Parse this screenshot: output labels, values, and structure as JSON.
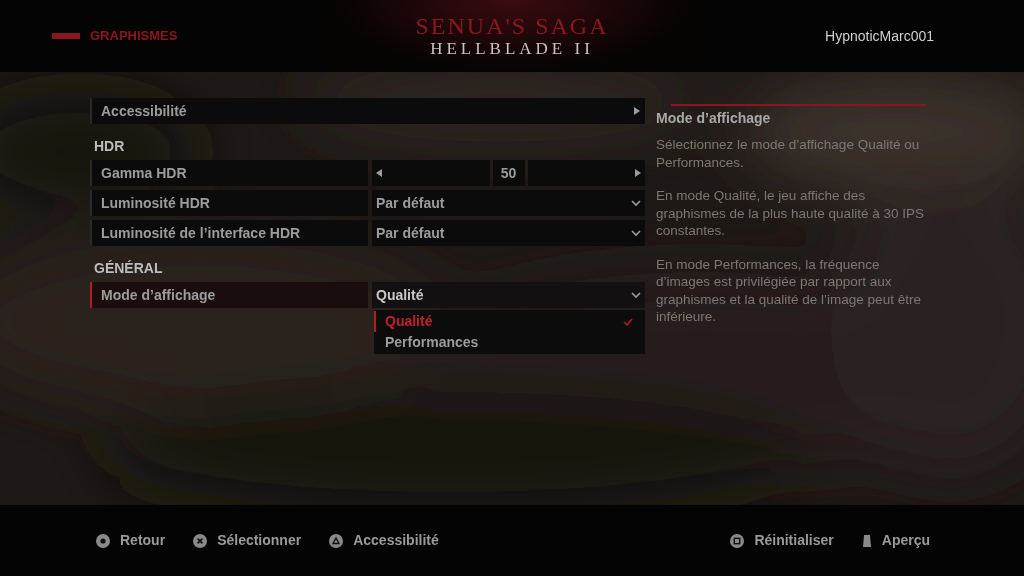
{
  "header": {
    "section": "GRAPHISMES",
    "logo_top": "SENUA'S SAGA",
    "logo_bottom": "HELLBLADE II",
    "user": "HypnoticMarc001"
  },
  "settings": [
    {
      "kind": "link",
      "label": "Accessibilité",
      "selected": false
    },
    {
      "kind": "section",
      "label": "HDR"
    },
    {
      "kind": "slider",
      "label": "Gamma HDR",
      "value": "50",
      "selected": false
    },
    {
      "kind": "dropdown",
      "label": "Luminosité HDR",
      "value": "Par défaut",
      "selected": false,
      "expanded": false
    },
    {
      "kind": "dropdown",
      "label": "Luminosité de l’interface HDR",
      "value": "Par défaut",
      "selected": false,
      "expanded": false
    },
    {
      "kind": "section",
      "label": "GÉNÉRAL"
    },
    {
      "kind": "dropdown",
      "label": "Mode d’affichage",
      "value": "Qualité",
      "selected": true,
      "expanded": true,
      "options": [
        {
          "label": "Qualité",
          "selected": true
        },
        {
          "label": "Performances",
          "selected": false
        }
      ]
    }
  ],
  "description": {
    "title": "Mode d’affichage",
    "paragraphs": [
      "Sélectionnez le mode d’affichage Qualité ou Performances.",
      "En mode Qualité, le jeu affiche des graphismes de la plus haute qualité à 30 IPS constantes.",
      "En mode Performances, la fréquence d’images est privilégiée par rapport aux graphismes et la qualité de l’image peut être inférieure."
    ]
  },
  "prompts_left": [
    {
      "kind": "circle",
      "label": "Retour"
    },
    {
      "kind": "cross",
      "label": "Sélectionner"
    },
    {
      "kind": "triangle",
      "label": "Accessibilité"
    }
  ],
  "prompts_right": [
    {
      "kind": "square",
      "label": "Réinitialiser"
    },
    {
      "kind": "touchpad",
      "label": "Aperçu"
    }
  ]
}
